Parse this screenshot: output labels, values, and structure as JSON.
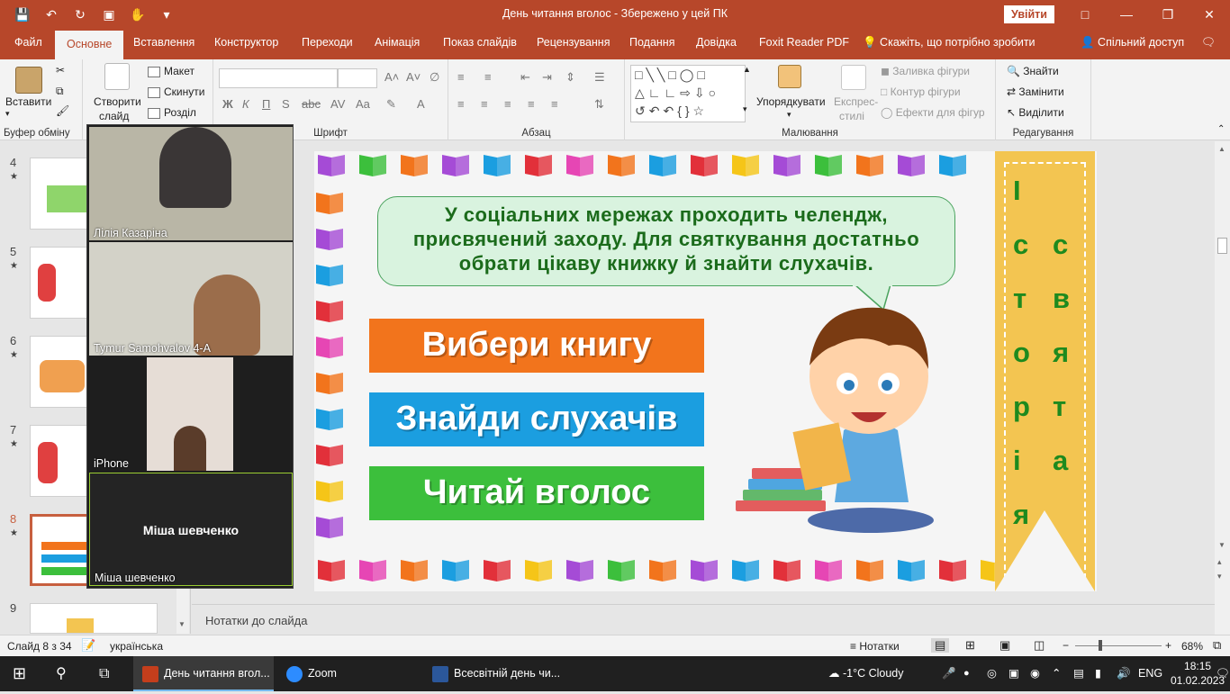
{
  "window": {
    "title": "День читання вголос  -  Збережено у цей ПК",
    "signin_label": "Увійти"
  },
  "tabs": [
    {
      "label": "Файл"
    },
    {
      "label": "Основне"
    },
    {
      "label": "Вставлення"
    },
    {
      "label": "Конструктор"
    },
    {
      "label": "Переходи"
    },
    {
      "label": "Анімація"
    },
    {
      "label": "Показ слайдів"
    },
    {
      "label": "Рецензування"
    },
    {
      "label": "Подання"
    },
    {
      "label": "Довідка"
    },
    {
      "label": "Foxit Reader PDF"
    }
  ],
  "tellme": "Скажіть, що потрібно зробити",
  "share": "Спільний доступ",
  "ribbon": {
    "paste": "Вставити",
    "clipboard_group": "Буфер обміну",
    "new_slide_line1": "Створити",
    "new_slide_line2": "слайд",
    "layout": "Макет",
    "reset": "Скинути",
    "section": "Розділ",
    "font_group": "Шрифт",
    "paragraph_group": "Абзац",
    "drawing_group": "Малювання",
    "arrange": "Упорядкувати",
    "quick_styles_line1": "Експрес-",
    "quick_styles_line2": "стилі",
    "shape_fill": "Заливка фігури",
    "shape_outline": "Контур фігури",
    "shape_effects": "Ефекти для фігур",
    "find": "Знайти",
    "replace": "Замінити",
    "select": "Виділити",
    "editing_group": "Редагування",
    "bold": "Ж",
    "italic": "К",
    "underline": "П",
    "strike": "S"
  },
  "slides_panel": [
    {
      "num": "4"
    },
    {
      "num": "5"
    },
    {
      "num": "6"
    },
    {
      "num": "7"
    },
    {
      "num": "8"
    },
    {
      "num": "9"
    }
  ],
  "video_tiles": [
    {
      "name": "Лілія Казаріна"
    },
    {
      "name": "Tymur Samohvalov 4-A"
    },
    {
      "name": "iPhone"
    },
    {
      "name": "Міша шевченко",
      "center_name": "Міша шевченко"
    }
  ],
  "slide": {
    "bubble_text_line1": "У соціальних мережах проходить челендж,",
    "bubble_text_line2": "присвячений заходу. Для святкування достатньо",
    "bubble_text_line3": "обрати цікаву книжку й знайти слухачів.",
    "banners": [
      {
        "text": "Вибери  книгу",
        "color": "#f2741c"
      },
      {
        "text": "Знайди слухачів",
        "color": "#1b9ee0"
      },
      {
        "text": "Читай вголос",
        "color": "#3cbf3c"
      }
    ],
    "ribbon_col1": [
      "І",
      "с",
      "т",
      "о",
      "р",
      "і",
      "я"
    ],
    "ribbon_col2": [
      "с",
      "в",
      "я",
      "т",
      "а"
    ]
  },
  "notes_placeholder": "Нотатки до слайда",
  "status": {
    "slide_of": "Слайд 8 з 34",
    "language": "українська",
    "notes": "Нотатки",
    "zoom": "68%"
  },
  "taskbar": {
    "apps": [
      {
        "label": "День читання вгол..."
      },
      {
        "label": "Zoom"
      },
      {
        "label": "Всесвітній день чи..."
      }
    ],
    "weather": "-1°C  Cloudy",
    "lang": "ENG",
    "time": "18:15",
    "date": "01.02.2023"
  }
}
